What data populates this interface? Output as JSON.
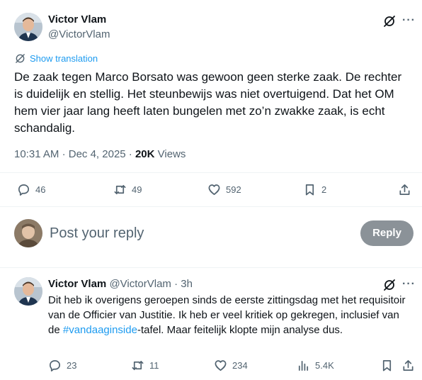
{
  "main_tweet": {
    "author_name": "Victor Vlam",
    "author_handle": "@VictorVlam",
    "show_translation": "Show translation",
    "text": "De zaak tegen Marco Borsato was gewoon geen sterke zaak. De rechter is duidelijk en stellig. Het steunbewijs was niet overtuigend. Dat het OM hem vier jaar lang heeft laten bungelen met zo’n zwakke zaak, is echt schandalig.",
    "time": "10:31 AM",
    "date": "Dec 4, 2025",
    "separator": "·",
    "views_count": "20K",
    "views_label": "Views",
    "actions": {
      "replies": "46",
      "reposts": "49",
      "likes": "592",
      "bookmarks": "2"
    }
  },
  "composer": {
    "placeholder": "Post your reply",
    "reply_button": "Reply"
  },
  "reply_tweet": {
    "author_name": "Victor Vlam",
    "author_handle": "@VictorVlam",
    "separator": "·",
    "time_ago": "3h",
    "text_before": "Dit heb ik overigens geroepen sinds de eerste zittingsdag met het requisitoir van de Officier van Justitie. Ik heb er veel kritiek op gekregen, inclusief van de ",
    "hashtag": "#vandaaginside",
    "text_after": "-tafel. Maar feitelijk klopte mijn analyse dus.",
    "actions": {
      "replies": "23",
      "reposts": "11",
      "likes": "234",
      "views": "5.4K"
    }
  },
  "more_glyph": "···"
}
